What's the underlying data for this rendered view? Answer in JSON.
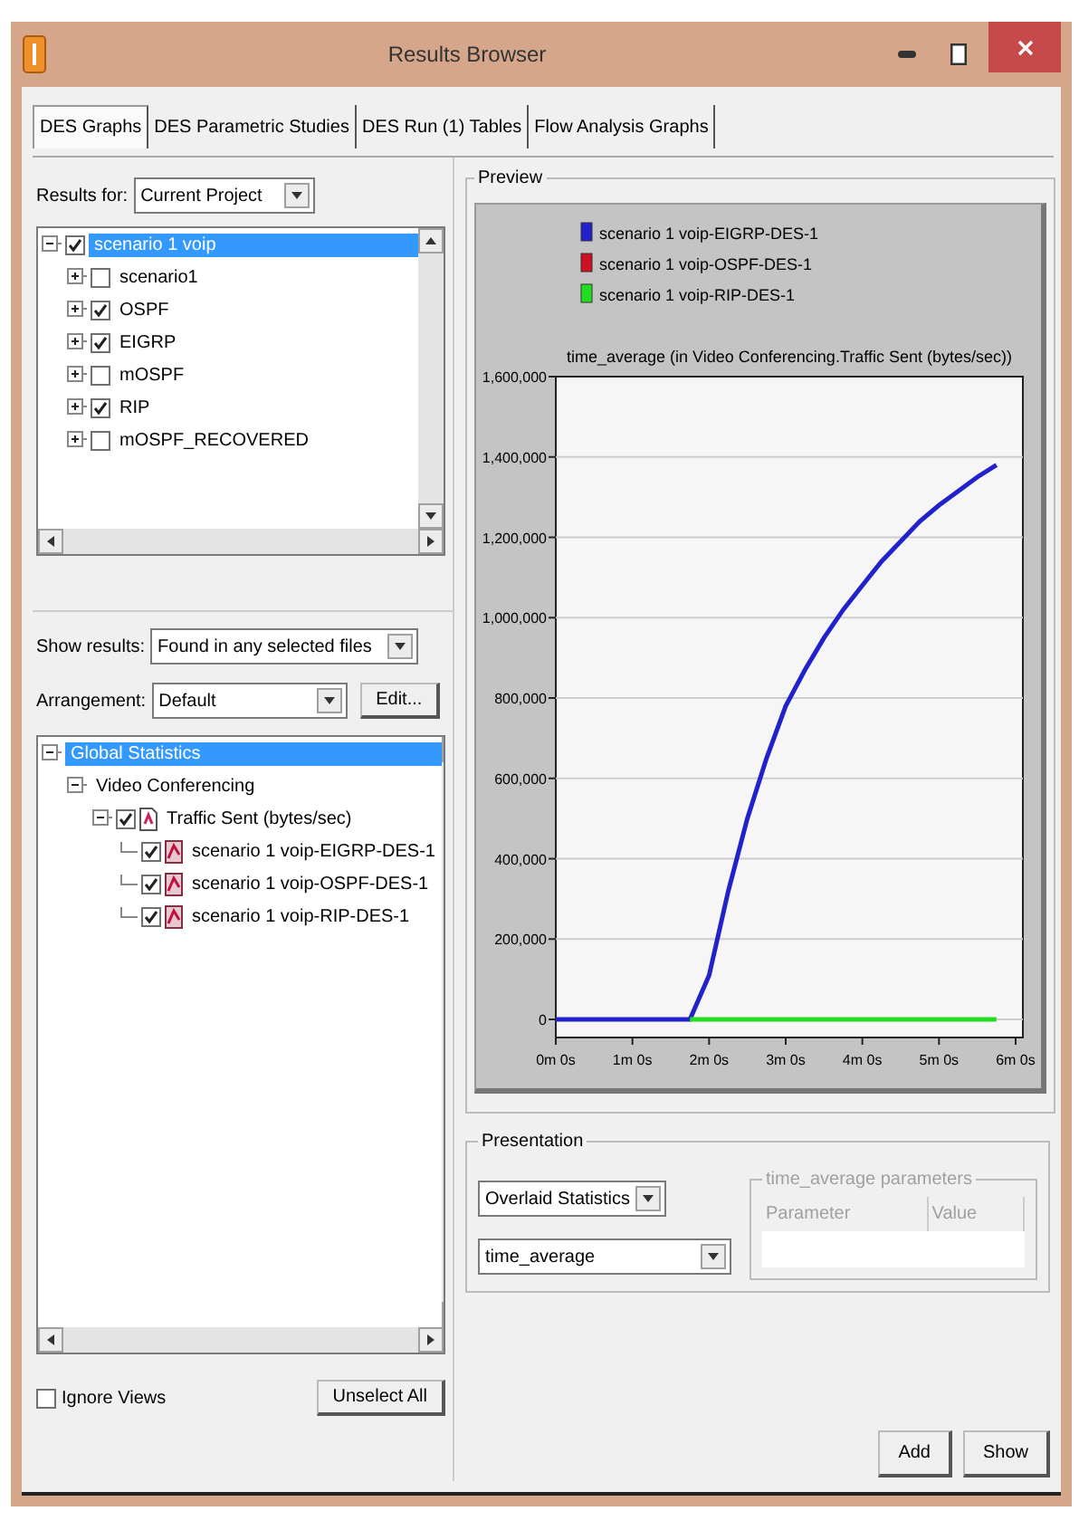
{
  "window": {
    "title": "Results Browser"
  },
  "tabs": [
    {
      "label": "DES Graphs",
      "selected": true
    },
    {
      "label": "DES Parametric Studies",
      "selected": false
    },
    {
      "label": "DES Run (1) Tables",
      "selected": false
    },
    {
      "label": "Flow Analysis Graphs",
      "selected": false
    }
  ],
  "results_for": {
    "label": "Results for:",
    "value": "Current Project"
  },
  "project_tree": [
    {
      "label": "scenario 1 voip",
      "checked": true,
      "selected": true,
      "expanded": true,
      "children": [
        {
          "label": "scenario1",
          "checked": false,
          "selected": false,
          "expanded": false
        },
        {
          "label": "OSPF",
          "checked": true,
          "selected": false,
          "expanded": false
        },
        {
          "label": "EIGRP",
          "checked": true,
          "selected": false,
          "expanded": false
        },
        {
          "label": "mOSPF",
          "checked": false,
          "selected": false,
          "expanded": false
        },
        {
          "label": "RIP",
          "checked": true,
          "selected": false,
          "expanded": false
        },
        {
          "label": "mOSPF_RECOVERED",
          "checked": false,
          "selected": false,
          "expanded": false
        }
      ]
    }
  ],
  "show_results": {
    "label": "Show results:",
    "value": "Found in any selected files"
  },
  "arrangement": {
    "label": "Arrangement:",
    "value": "Default",
    "button": "Edit..."
  },
  "statistics_tree": [
    {
      "label": "Global Statistics",
      "selected": true,
      "expanded": true,
      "children": [
        {
          "label": "Video Conferencing",
          "selected": false,
          "expanded": true,
          "children": [
            {
              "label": "Traffic Sent (bytes/sec)",
              "kind": "statistic",
              "checked": true,
              "selected": false,
              "expanded": true,
              "children": [
                {
                  "label": "scenario 1 voip-EIGRP-DES-1",
                  "kind": "series",
                  "checked": true,
                  "selected": false
                },
                {
                  "label": "scenario 1 voip-OSPF-DES-1",
                  "kind": "series",
                  "checked": true,
                  "selected": false
                },
                {
                  "label": "scenario 1 voip-RIP-DES-1",
                  "kind": "series",
                  "checked": true,
                  "selected": false
                }
              ]
            }
          ]
        }
      ]
    }
  ],
  "ignore_views": {
    "label": "Ignore Views",
    "checked": false
  },
  "unselect_all": "Unselect All",
  "preview": {
    "title": "Preview",
    "chart_data": {
      "type": "line",
      "title": "time_average (in Video Conferencing.Traffic Sent (bytes/sec))",
      "categories": [
        "0m 0s",
        null,
        null,
        null,
        "1m 0s",
        null,
        null,
        null,
        "2m 0s",
        null,
        null,
        null,
        "3m 0s",
        null,
        null,
        null,
        "4m 0s",
        null,
        null,
        null,
        "5m 0s",
        null,
        null,
        null,
        "6m 0s"
      ],
      "series": [
        {
          "name": "scenario 1 voip-EIGRP-DES-1",
          "color": "#2222cc",
          "values": [
            0,
            0,
            0,
            0,
            0,
            0,
            0,
            0,
            110000,
            320000,
            500000,
            650000,
            780000,
            870000,
            950000,
            1020000,
            1080000,
            1140000,
            1190000,
            1240000,
            1280000,
            1315000,
            1350000,
            1380000,
            null
          ]
        },
        {
          "name": "scenario 1 voip-OSPF-DES-1",
          "color": "#cc1122",
          "values": [
            null,
            null,
            null,
            null,
            null,
            null,
            null,
            null,
            null,
            null,
            null,
            null,
            null,
            null,
            null,
            null,
            null,
            null,
            null,
            null,
            null,
            null,
            null,
            null,
            null
          ]
        },
        {
          "name": "scenario 1 voip-RIP-DES-1",
          "color": "#22dd22",
          "values": [
            null,
            null,
            null,
            null,
            null,
            null,
            null,
            0,
            0,
            0,
            0,
            0,
            0,
            0,
            0,
            0,
            0,
            0,
            0,
            0,
            0,
            0,
            0,
            0,
            null
          ]
        }
      ],
      "ylim": [
        -45000,
        1600000
      ],
      "grid": true,
      "legend": true,
      "yticks": [
        {
          "value": 0,
          "label": "0"
        },
        {
          "value": 200000,
          "label": "200,000"
        },
        {
          "value": 400000,
          "label": "400,000"
        },
        {
          "value": 600000,
          "label": "600,000"
        },
        {
          "value": 800000,
          "label": "800,000"
        },
        {
          "value": 1000000,
          "label": "1,000,000"
        },
        {
          "value": 1200000,
          "label": "1,200,000"
        },
        {
          "value": 1400000,
          "label": "1,400,000"
        },
        {
          "value": 1600000,
          "label": "1,600,000"
        }
      ]
    }
  },
  "presentation": {
    "title": "Presentation",
    "mode": "Overlaid Statistics",
    "filter": "time_average",
    "parameters": {
      "title": "time_average parameters",
      "disabled": true,
      "columns": [
        "Parameter",
        "Value"
      ]
    }
  },
  "buttons": [
    "Add",
    "Show"
  ]
}
